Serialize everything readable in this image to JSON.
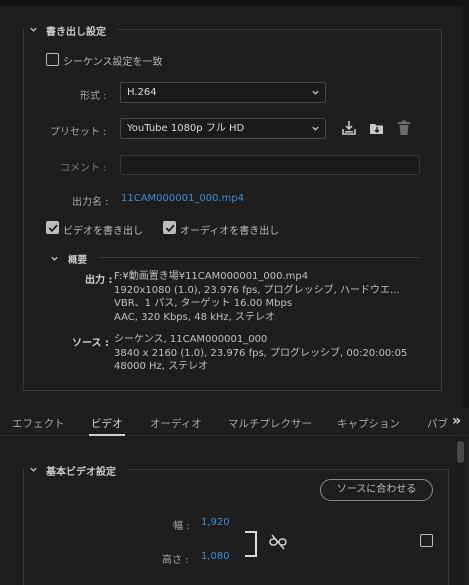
{
  "export_settings": {
    "section_title": "書き出し設定",
    "match_sequence_label": "シーケンス設定を一致",
    "match_sequence_checked": false,
    "format_label": "形式 :",
    "format_value": "H.264",
    "preset_label": "プリセット :",
    "preset_value": "YouTube  1080p フル HD",
    "comment_label": "コメント :",
    "comment_value": "",
    "output_name_label": "出力名 :",
    "output_name_value": "11CAM000001_000.mp4",
    "export_video_label": "ビデオを書き出し",
    "export_video_checked": true,
    "export_audio_label": "オーディオを書き出し",
    "export_audio_checked": true,
    "icons": [
      "save-preset-icon",
      "import-preset-icon",
      "delete-preset-icon"
    ]
  },
  "summary": {
    "title": "概要",
    "output_label": "出力 :",
    "output_lines": [
      "F:¥動画置き場¥11CAM000001_000.mp4",
      "1920x1080 (1.0), 23.976 fps, プログレッシブ, ハードウエ...",
      "VBR、1 パス, ターゲット 16.00 Mbps",
      "AAC, 320 Kbps, 48 kHz, ステレオ"
    ],
    "source_label": "ソース :",
    "source_lines": [
      "シーケンス, 11CAM000001_000",
      "3840 x 2160 (1.0), 23.976 fps, プログレッシブ, 00:20:00:05",
      "48000  Hz, ステレオ"
    ]
  },
  "tabs": {
    "items": [
      "エフェクト",
      "ビデオ",
      "オーディオ",
      "マルチプレクサー",
      "キャプション",
      "パブ"
    ],
    "active": "ビデオ",
    "overflow": "»"
  },
  "basic_video": {
    "section_title": "基本ビデオ設定",
    "match_source_button": "ソースに合わせる",
    "width_label": "幅 :",
    "width_value": "1,920",
    "height_label": "高さ :",
    "height_value": "1,080",
    "link_checked": false
  },
  "colors": {
    "background": "#1e1e1e",
    "accent_blue": "#3a8fd8",
    "border": "#3a3a3a"
  }
}
